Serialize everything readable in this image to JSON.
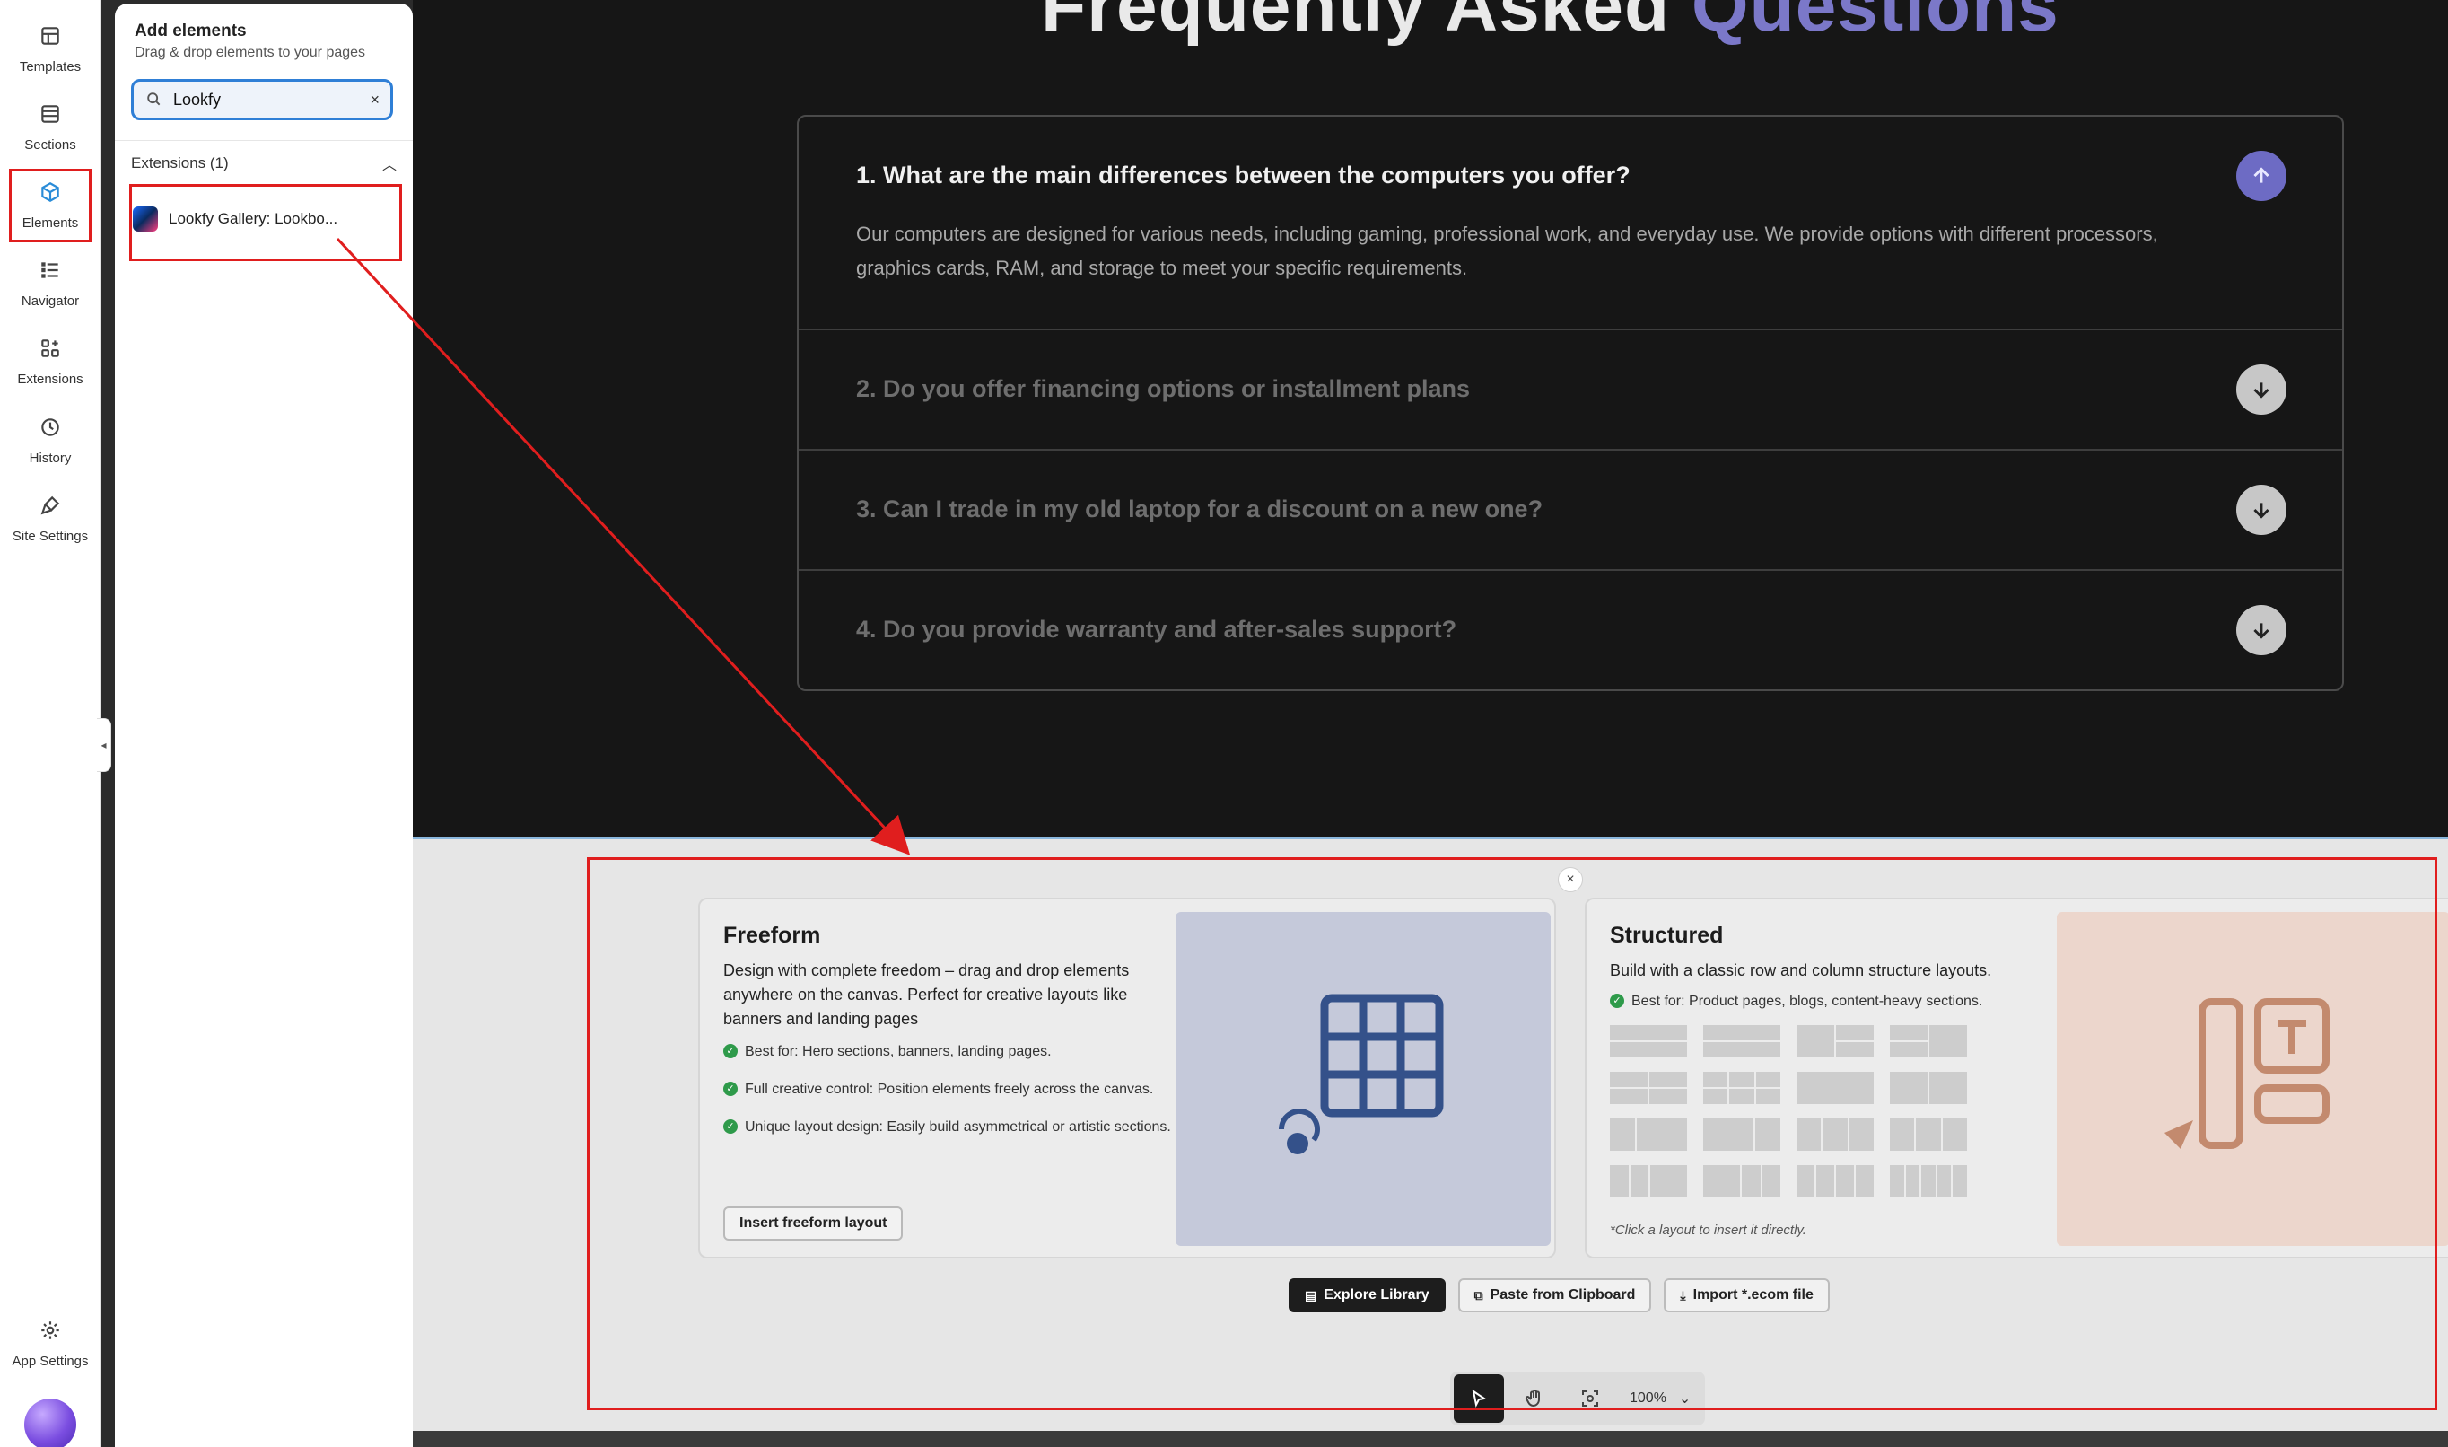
{
  "rail": {
    "items": [
      {
        "label": "Templates",
        "icon": "templates-icon"
      },
      {
        "label": "Sections",
        "icon": "sections-icon"
      },
      {
        "label": "Elements",
        "icon": "cube-icon",
        "active": true
      },
      {
        "label": "Navigator",
        "icon": "list-icon"
      },
      {
        "label": "Extensions",
        "icon": "extensions-icon"
      },
      {
        "label": "History",
        "icon": "clock-icon"
      },
      {
        "label": "Site Settings",
        "icon": "brush-icon"
      }
    ],
    "app_settings": "App Settings"
  },
  "panel": {
    "title": "Add elements",
    "subtitle": "Drag & drop elements to your pages",
    "search_value": "Lookfy",
    "extensions_header": "Extensions (1)",
    "extension_item": "Lookfy Gallery: Lookbo..."
  },
  "faq": {
    "title_white": "Frequently Asked",
    "title_accent": "Questions",
    "items": [
      {
        "q": "1. What are the main differences between the computers you offer?",
        "a": "Our computers are designed for various needs, including gaming, professional work, and everyday use. We provide options with different processors, graphics cards, RAM, and storage to meet your specific requirements."
      },
      {
        "q": "2. Do you offer financing options or installment plans"
      },
      {
        "q": "3. Can I trade in my old laptop for a discount on a new one?"
      },
      {
        "q": "4. Do you provide warranty and after-sales support?"
      }
    ]
  },
  "chooser": {
    "close": "×",
    "freeform": {
      "title": "Freeform",
      "desc": "Design with complete freedom – drag and drop elements anywhere on the canvas. Perfect for creative layouts like banners and landing pages",
      "bullets": [
        "Best for: Hero sections, banners, landing pages.",
        "Full creative control: Position elements freely across the canvas.",
        "Unique layout design: Easily build asymmetrical or artistic sections."
      ],
      "button": "Insert freeform layout"
    },
    "structured": {
      "title": "Structured",
      "desc": "Build with a classic row and column structure layouts.",
      "bullets": [
        "Best for: Product pages, blogs, content-heavy sections."
      ],
      "note": "*Click a layout to insert it directly."
    },
    "actions": {
      "explore": "Explore Library",
      "paste": "Paste from Clipboard",
      "import": "Import *.ecom file"
    }
  },
  "toolbar": {
    "zoom": "100%"
  },
  "colors": {
    "accent_purple": "#7b78c9",
    "annotation_red": "#e01e1e",
    "selection_blue": "#2f7fd6"
  }
}
